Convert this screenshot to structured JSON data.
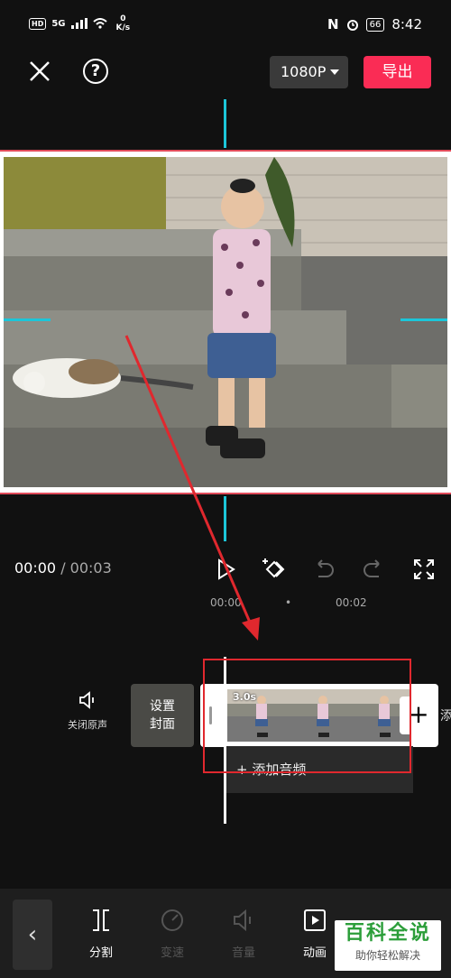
{
  "status_bar": {
    "hd": "HD",
    "network": "5G",
    "speed_value": "0",
    "speed_unit": "K/s",
    "nfc": "N",
    "battery": "66",
    "time": "8:42"
  },
  "top_bar": {
    "resolution": "1080P",
    "export_label": "导出"
  },
  "playback": {
    "current_time": "00:00",
    "separator": " / ",
    "total_time": "00:03"
  },
  "timeline": {
    "ruler_labels": [
      "00:00",
      "•",
      "00:02"
    ],
    "mute_label": "关闭原声",
    "cover_label_1": "设置",
    "cover_label_2": "封面",
    "clip_duration": "3.0s",
    "add_clip": "+",
    "add_more_partial": "添",
    "add_audio_label": "+ 添加音频"
  },
  "toolbar": {
    "back": "‹",
    "items": [
      {
        "label": "分割",
        "icon": "split-icon",
        "enabled": true
      },
      {
        "label": "变速",
        "icon": "speed-icon",
        "enabled": false
      },
      {
        "label": "音量",
        "icon": "volume-icon",
        "enabled": false
      },
      {
        "label": "动画",
        "icon": "animation-icon",
        "enabled": true
      }
    ]
  },
  "watermark": {
    "title": "百科全说",
    "subtitle": "助你轻松解决"
  },
  "colors": {
    "accent_cyan": "#1cc6d9",
    "export_red": "#fa2c55",
    "annotation_red": "#e0282e"
  }
}
